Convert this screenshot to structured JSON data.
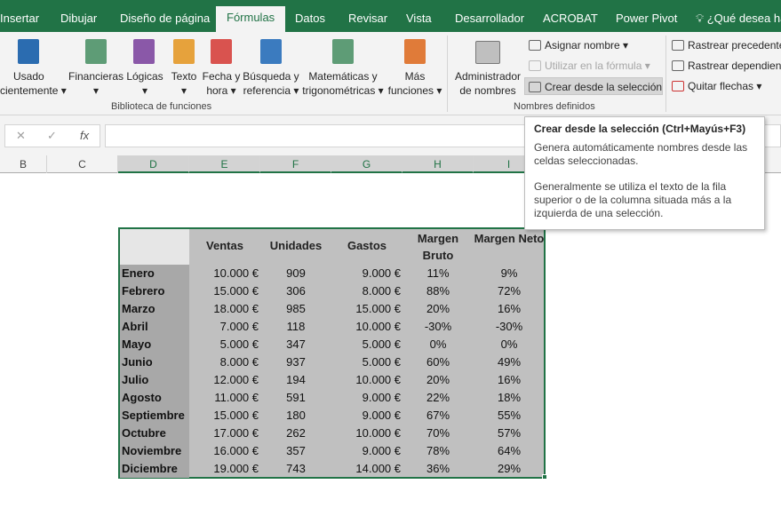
{
  "tabs": [
    "Insertar",
    "Dibujar",
    "Diseño de página",
    "Fórmulas",
    "Datos",
    "Revisar",
    "Vista",
    "Desarrollador",
    "ACROBAT",
    "Power Pivot"
  ],
  "tell_me": "¿Qué desea ha",
  "ribbon": {
    "group1": {
      "label": "Biblioteca de funciones",
      "buttons": [
        {
          "l1": "Usado",
          "l2": "cientemente ▾"
        },
        {
          "l1": "Financieras",
          "l2": "▾"
        },
        {
          "l1": "Lógicas",
          "l2": "▾"
        },
        {
          "l1": "Texto",
          "l2": "▾"
        },
        {
          "l1": "Fecha y",
          "l2": "hora ▾"
        },
        {
          "l1": "Búsqueda y",
          "l2": "referencia ▾"
        },
        {
          "l1": "Matemáticas y",
          "l2": "trigonométricas ▾"
        },
        {
          "l1": "Más",
          "l2": "funciones ▾"
        }
      ]
    },
    "group2": {
      "label": "Nombres definidos",
      "admin_l1": "Administrador",
      "admin_l2": "de nombres",
      "assign": "Asignar nombre  ▾",
      "use": "Utilizar en la fórmula ▾",
      "create": "Crear desde la selección"
    },
    "group3": {
      "trace_prec": "Rastrear precedente",
      "trace_dep": "Rastrear dependient",
      "remove": "Quitar flechas  ▾"
    }
  },
  "formula_bar": {
    "cancel": "✕",
    "enter": "✓",
    "fx": "fx"
  },
  "columns": [
    "B",
    "C",
    "D",
    "E",
    "F",
    "G",
    "H",
    "I"
  ],
  "table": {
    "headers": [
      "Ventas",
      "Unidades",
      "Gastos",
      "Margen Bruto",
      "Margen Neto"
    ],
    "rows": [
      [
        "Enero",
        "10.000 €",
        "909",
        "9.000 €",
        "11%",
        "9%"
      ],
      [
        "Febrero",
        "15.000 €",
        "306",
        "8.000 €",
        "88%",
        "72%"
      ],
      [
        "Marzo",
        "18.000 €",
        "985",
        "15.000 €",
        "20%",
        "16%"
      ],
      [
        "Abril",
        "7.000 €",
        "118",
        "10.000 €",
        "-30%",
        "-30%"
      ],
      [
        "Mayo",
        "5.000 €",
        "347",
        "5.000 €",
        "0%",
        "0%"
      ],
      [
        "Junio",
        "8.000 €",
        "937",
        "5.000 €",
        "60%",
        "49%"
      ],
      [
        "Julio",
        "12.000 €",
        "194",
        "10.000 €",
        "20%",
        "16%"
      ],
      [
        "Agosto",
        "11.000 €",
        "591",
        "9.000 €",
        "22%",
        "18%"
      ],
      [
        "Septiembre",
        "15.000 €",
        "180",
        "9.000 €",
        "67%",
        "55%"
      ],
      [
        "Octubre",
        "17.000 €",
        "262",
        "10.000 €",
        "70%",
        "57%"
      ],
      [
        "Noviembre",
        "16.000 €",
        "357",
        "9.000 €",
        "78%",
        "64%"
      ],
      [
        "Diciembre",
        "19.000 €",
        "743",
        "14.000 €",
        "36%",
        "29%"
      ]
    ]
  },
  "tooltip": {
    "title": "Crear desde la selección (Ctrl+Mayús+F3)",
    "p1": "Genera automáticamente nombres desde las celdas seleccionadas.",
    "p2": "Generalmente se utiliza el texto de la fila superior o de la columna situada más a la izquierda de una selección."
  },
  "colors": {
    "accent": "#217346",
    "selection": "#c0c0c0"
  }
}
